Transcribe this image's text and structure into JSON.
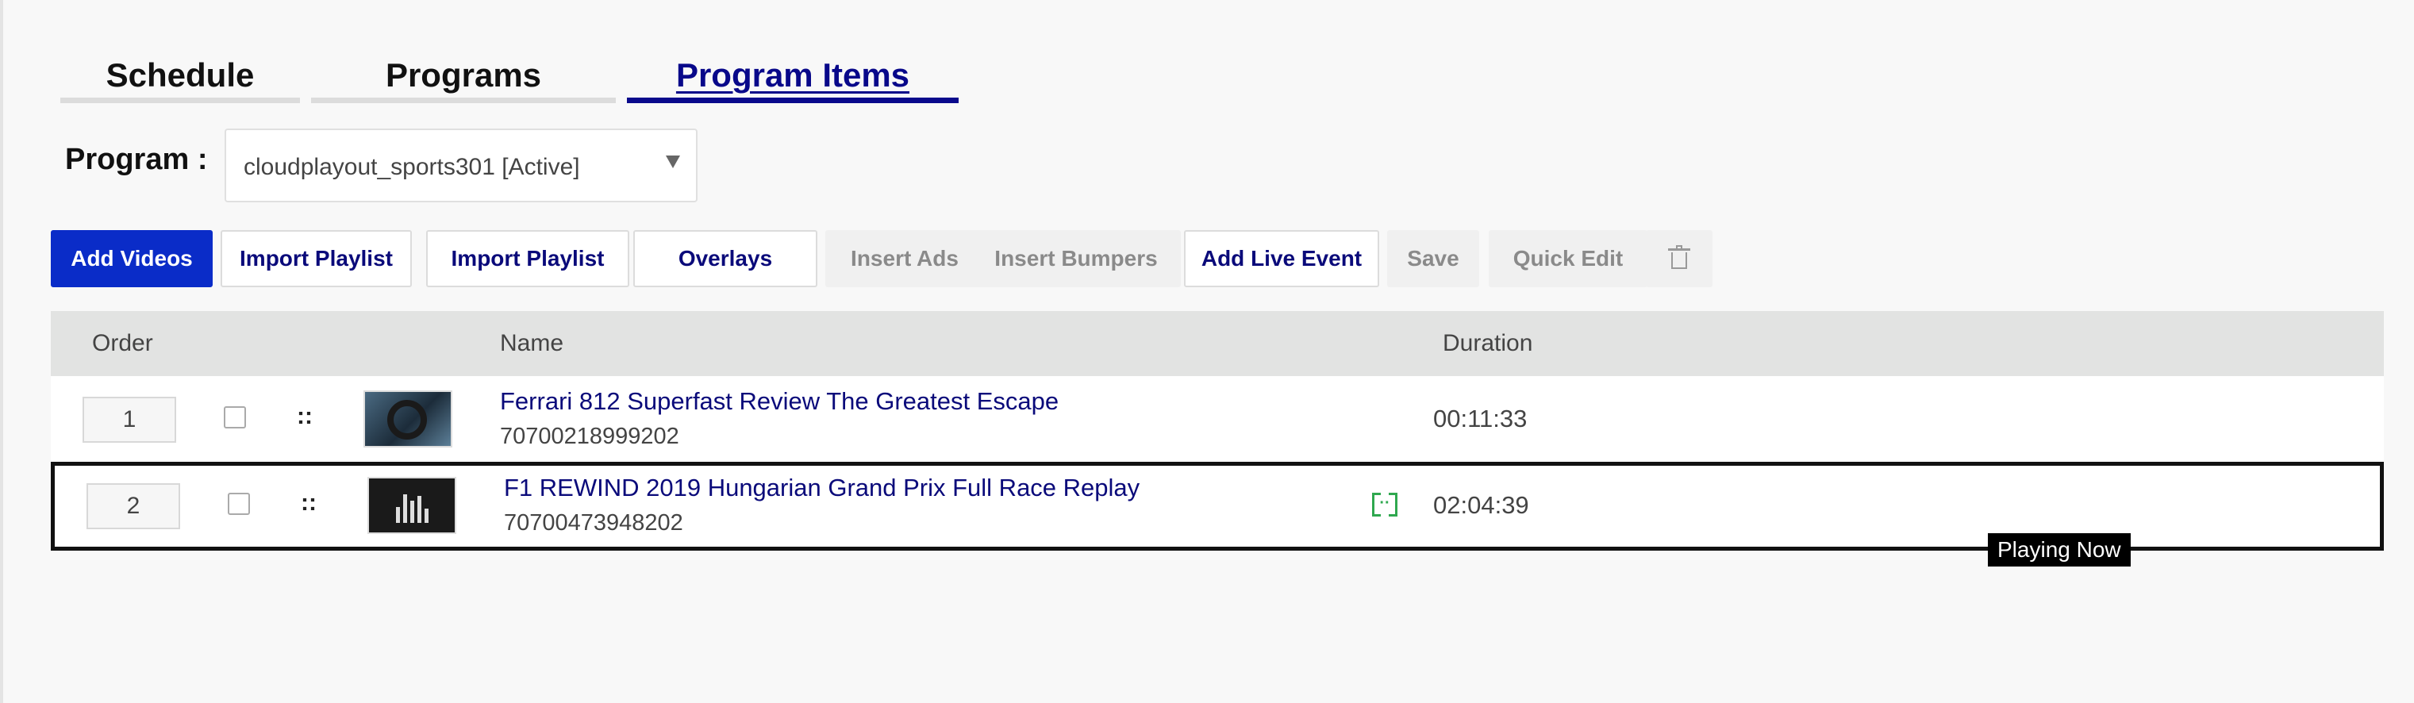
{
  "tabs": [
    {
      "label": "Schedule",
      "active": false
    },
    {
      "label": "Programs",
      "active": false
    },
    {
      "label": "Program Items",
      "active": true
    }
  ],
  "program": {
    "label": "Program :",
    "selected": "cloudplayout_sports301 [Active]"
  },
  "toolbar": {
    "add_videos": "Add Videos",
    "import_playlist_1": "Import Playlist",
    "import_playlist_2": "Import Playlist",
    "overlays": "Overlays",
    "insert_ads": "Insert Ads",
    "insert_bumpers": "Insert Bumpers",
    "add_live_event": "Add Live Event",
    "save": "Save",
    "quick_edit": "Quick Edit",
    "delete_icon": "trash-icon"
  },
  "table": {
    "headers": {
      "order": "Order",
      "name": "Name",
      "duration": "Duration"
    },
    "rows": [
      {
        "order": "1",
        "title": "Ferrari 812 Superfast Review The Greatest Escape",
        "id": "70700218999202",
        "duration": "00:11:33",
        "playing": false
      },
      {
        "order": "2",
        "title": "F1 REWIND 2019 Hungarian Grand Prix Full Race Replay",
        "id": "70700473948202",
        "duration": "02:04:39",
        "playing": true,
        "status_icon": "live-stream-icon"
      }
    ]
  },
  "playing_badge": "Playing Now",
  "colors": {
    "primary": "#0a2cc8",
    "link": "#0a0a7a",
    "live_green": "#2fa84f"
  }
}
